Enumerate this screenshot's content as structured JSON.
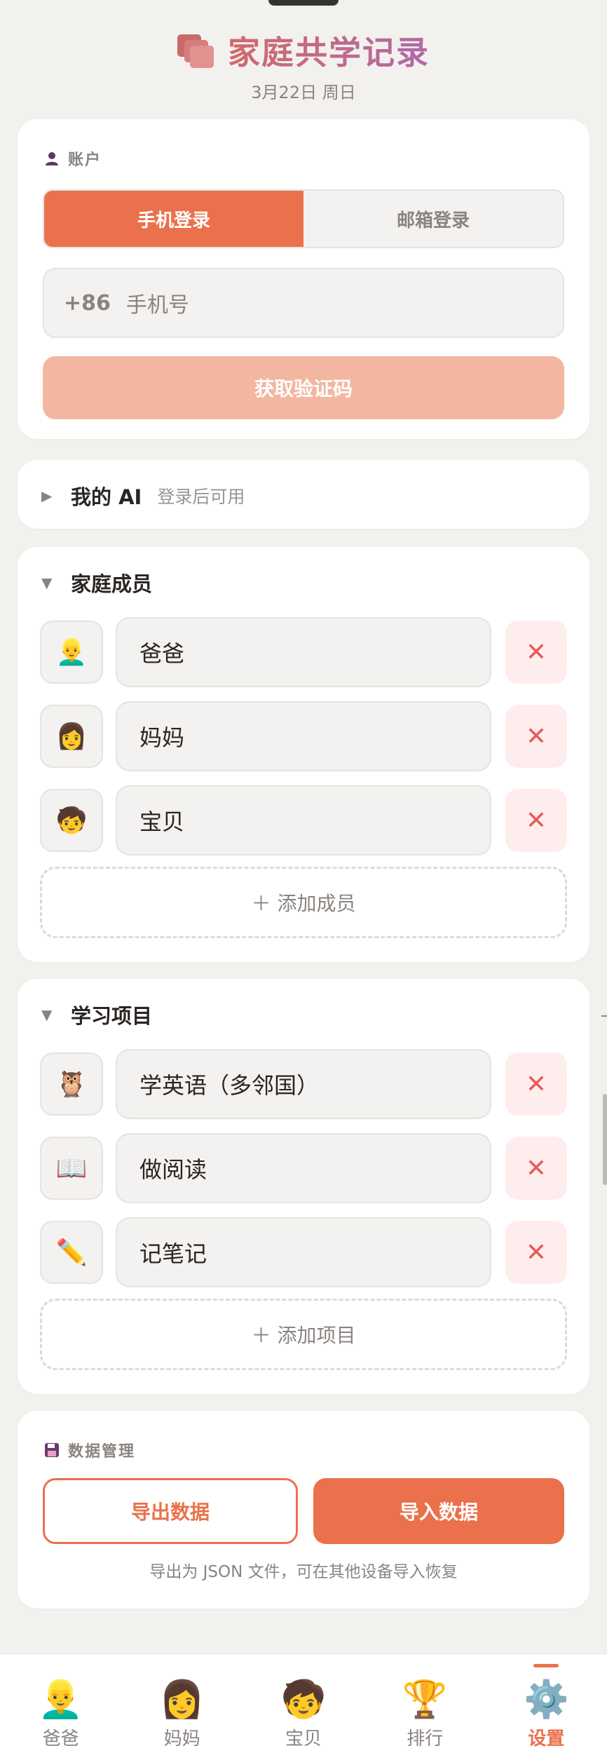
{
  "app": {
    "title": "家庭共学记录",
    "date": "3月22日 周日"
  },
  "account": {
    "section_label": "账户",
    "tabs": [
      {
        "label": "手机登录",
        "active": true
      },
      {
        "label": "邮箱登录",
        "active": false
      }
    ],
    "country_code": "+86",
    "phone_placeholder": "手机号",
    "get_code_label": "获取验证码"
  },
  "my_ai": {
    "title": "我的 AI",
    "subtitle": "登录后可用",
    "expanded": false
  },
  "members": {
    "title": "家庭成员",
    "expanded": true,
    "items": [
      {
        "icon": "dad-face-icon",
        "emoji": "👱‍♂️",
        "name": "爸爸"
      },
      {
        "icon": "mom-face-icon",
        "emoji": "👩",
        "name": "妈妈"
      },
      {
        "icon": "child-face-icon",
        "emoji": "🧒",
        "name": "宝贝"
      }
    ],
    "add_label": "＋ 添加成员"
  },
  "projects": {
    "title": "学习项目",
    "expanded": true,
    "items": [
      {
        "icon": "owl-icon",
        "emoji": "🦉",
        "name": "学英语（多邻国）"
      },
      {
        "icon": "book-icon",
        "emoji": "📖",
        "name": "做阅读"
      },
      {
        "icon": "pencil-icon",
        "emoji": "✏️",
        "name": "记笔记"
      }
    ],
    "add_label": "＋ 添加项目"
  },
  "data_mgmt": {
    "section_label": "数据管理",
    "export_label": "导出数据",
    "import_label": "导入数据",
    "hint": "导出为 JSON 文件，可在其他设备导入恢复"
  },
  "tabbar": [
    {
      "label": "爸爸",
      "emoji": "👱‍♂️",
      "icon": "dad-face-icon",
      "active": false
    },
    {
      "label": "妈妈",
      "emoji": "👩",
      "icon": "mom-face-icon",
      "active": false
    },
    {
      "label": "宝贝",
      "emoji": "🧒",
      "icon": "child-face-icon",
      "active": false
    },
    {
      "label": "排行",
      "emoji": "🏆",
      "icon": "trophy-icon",
      "active": false
    },
    {
      "label": "设置",
      "emoji": "⚙️",
      "icon": "gear-icon",
      "active": true
    }
  ],
  "colors": {
    "accent": "#ea714c",
    "danger": "#e45d5d",
    "background": "#f3f1ee"
  }
}
